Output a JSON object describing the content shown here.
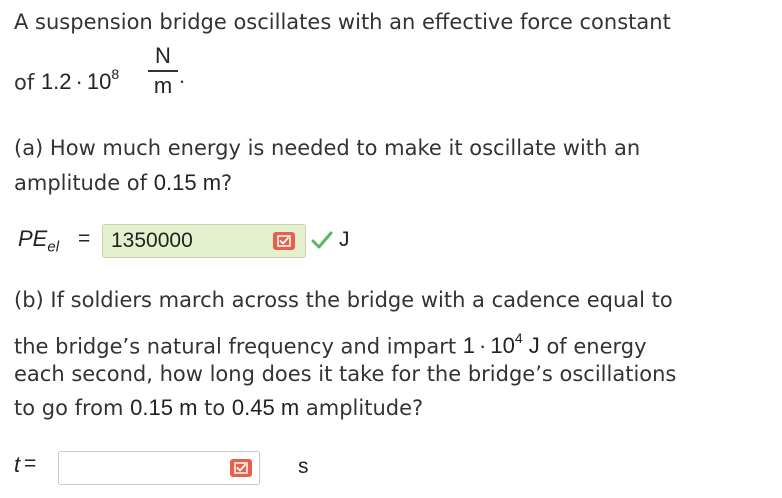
{
  "intro": {
    "line1": "A suspension bridge oscillates with an effective force constant",
    "line2_prefix": "of",
    "k_mantissa": "1.2",
    "k_times": "·",
    "k_base": "10",
    "k_exp": "8",
    "unit_num": "N",
    "unit_den": "m",
    "period": "."
  },
  "part_a": {
    "line1": "(a) How much energy is needed to make it oscillate with an",
    "line2_prefix": "amplitude of",
    "amplitude": "0.15",
    "amplitude_unit": "m",
    "line2_suffix": "?",
    "var_main": "PE",
    "var_sub": "el",
    "equals": "=",
    "answer_value": "1350000",
    "answer_status": "correct",
    "unit": "J"
  },
  "part_b": {
    "line1": "(b) If soldiers march across the bridge with a cadence equal to",
    "line2_prefix": "the bridge’s natural frequency and impart",
    "energy_mantissa": "1",
    "energy_times": "·",
    "energy_base": "10",
    "energy_exp": "4",
    "energy_unit": "J",
    "line2_suffix": "of energy",
    "line3": "each second, how long does it take for the bridge’s oscillations",
    "line4_prefix": "to go from",
    "from_amp": "0.15",
    "from_unit": "m",
    "to_word": "to",
    "to_amp": "0.45",
    "to_unit": "m",
    "line4_suffix": "amplitude?",
    "var": "t",
    "equals": "=",
    "answer_value": "",
    "unit": "s"
  },
  "colors": {
    "correct_bg": "#e4f1cf",
    "flag": "#e8604c",
    "check": "#5cb85c"
  },
  "icons": {
    "flag": "flag-icon",
    "check": "checkmark-icon"
  }
}
